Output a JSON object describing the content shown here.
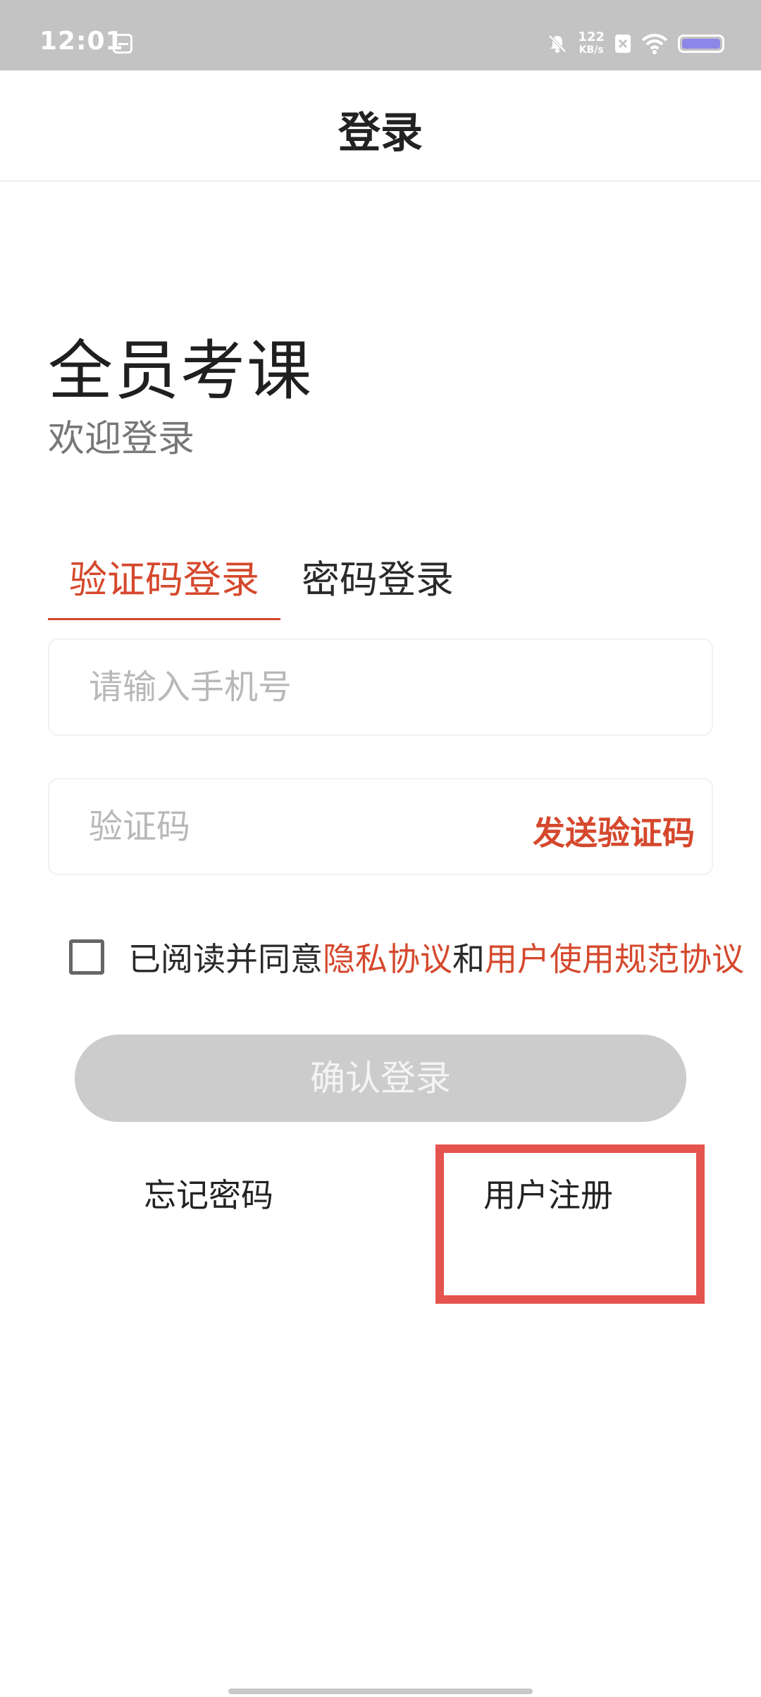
{
  "status_bar": {
    "time": "12:01",
    "network_speed_value": "122",
    "network_speed_unit": "KB/s",
    "icons": [
      "calendar-notification-icon",
      "bell-muted-icon",
      "no-sim-icon",
      "wifi-icon",
      "battery-icon"
    ],
    "battery_fill_color": "#8c86e8"
  },
  "header": {
    "title": "登录"
  },
  "brand": {
    "title": "全员考课",
    "subtitle": "欢迎登录"
  },
  "tabs": [
    {
      "label": "验证码登录",
      "active": true
    },
    {
      "label": "密码登录",
      "active": false
    }
  ],
  "form": {
    "phone_placeholder": "请输入手机号",
    "code_placeholder": "验证码",
    "send_code_label": "发送验证码"
  },
  "agreement": {
    "prefix": "已阅读并同意",
    "privacy_link": "隐私协议",
    "joiner": "和",
    "terms_link": "用户使用规范协议",
    "checked": false
  },
  "login_button": {
    "label": "确认登录"
  },
  "links": {
    "forgot_password": "忘记密码",
    "register": "用户注册"
  },
  "colors": {
    "accent": "#d5482d",
    "highlight": "#e5534f",
    "disabled_button": "#cccccc"
  }
}
